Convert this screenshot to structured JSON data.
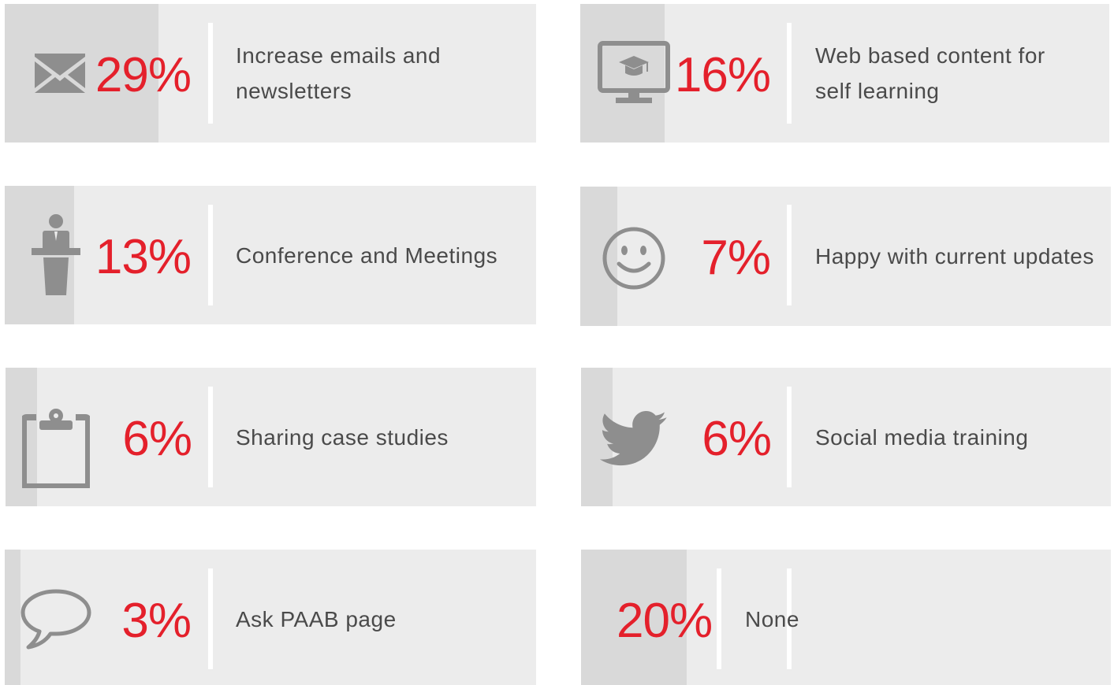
{
  "chart_data": {
    "type": "bar",
    "categories": [
      "Increase emails and newsletters",
      "Web based content for self learning",
      "Conference and Meetings",
      "Happy with current updates",
      "Sharing case studies",
      "Social media training",
      "Ask PAAB page",
      "None"
    ],
    "values": [
      29,
      16,
      13,
      7,
      6,
      6,
      3,
      20
    ],
    "unit": "%",
    "ylim": [
      0,
      100
    ],
    "grid": false,
    "legend": "none"
  },
  "colors": {
    "value": "#e4202b",
    "card": "#ececec",
    "fill": "#d9d9d9",
    "icon": "#8e8e8e",
    "text": "#4a4a4a"
  },
  "items": [
    {
      "value_text": "29%",
      "label_lines": [
        "Increase emails and",
        "newsletters"
      ],
      "icon": "envelope-icon"
    },
    {
      "value_text": "16%",
      "label_lines": [
        "Web based content for",
        "self learning"
      ],
      "icon": "monitor-graduation-cap-icon"
    },
    {
      "value_text": "13%",
      "label_lines": [
        "Conference and Meetings"
      ],
      "icon": "speaker-podium-icon"
    },
    {
      "value_text": "7%",
      "label_lines": [
        "Happy with current updates"
      ],
      "icon": "smiley-face-icon"
    },
    {
      "value_text": "6%",
      "label_lines": [
        "Sharing case studies"
      ],
      "icon": "clipboard-icon"
    },
    {
      "value_text": "6%",
      "label_lines": [
        "Social media training"
      ],
      "icon": "twitter-bird-icon"
    },
    {
      "value_text": "3%",
      "label_lines": [
        "Ask PAAB page"
      ],
      "icon": "speech-bubble-icon"
    },
    {
      "value_text": "20%",
      "label_lines": [
        "None"
      ],
      "icon": ""
    }
  ]
}
